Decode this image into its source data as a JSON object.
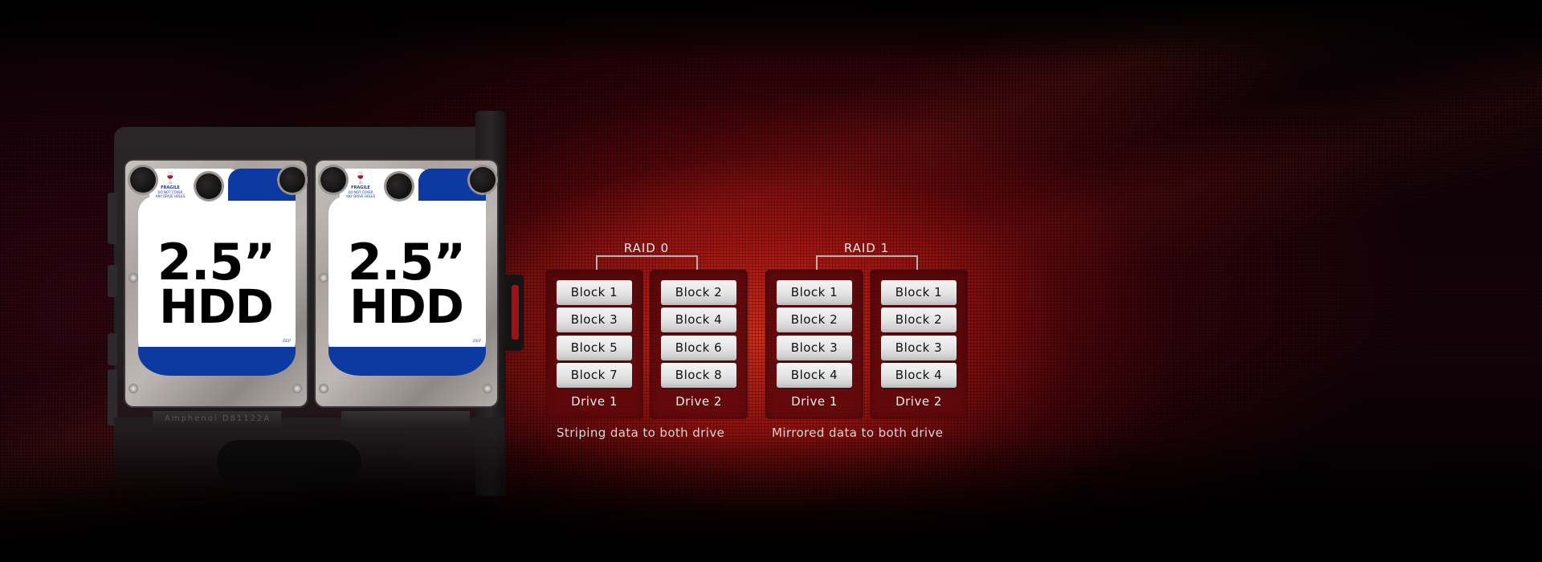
{
  "hdds": [
    {
      "size": "2.5”",
      "type": "HDD",
      "warning_title": "FRAGILE",
      "warning_line1": "DO NOT COVER",
      "warning_line2": "ANY DRIVE HOLES",
      "model_code": "ZEP"
    },
    {
      "size": "2.5”",
      "type": "HDD",
      "warning_title": "FRAGILE",
      "warning_line1": "DO NOT COVER",
      "warning_line2": "ANY DRIVE HOLES",
      "model_code": "ZEP"
    }
  ],
  "connector_label": "Amphenol    D81122A",
  "raid_groups": [
    {
      "title": "RAID 0",
      "caption": "Striping data to both drive",
      "drives": [
        {
          "label": "Drive 1",
          "blocks": [
            "Block 1",
            "Block 3",
            "Block 5",
            "Block 7"
          ]
        },
        {
          "label": "Drive 2",
          "blocks": [
            "Block 2",
            "Block 4",
            "Block 6",
            "Block 8"
          ]
        }
      ]
    },
    {
      "title": "RAID 1",
      "caption": "Mirrored data to both drive",
      "drives": [
        {
          "label": "Drive 1",
          "blocks": [
            "Block 1",
            "Block 2",
            "Block 3",
            "Block 4"
          ]
        },
        {
          "label": "Drive 2",
          "blocks": [
            "Block 1",
            "Block 2",
            "Block 3",
            "Block 4"
          ]
        }
      ]
    }
  ],
  "colors": {
    "accent_red": "#c81e14",
    "hdd_label_blue": "#0d3aa0",
    "block_face": "#e5e5e5",
    "panel_dark_red": "#5a070b"
  }
}
